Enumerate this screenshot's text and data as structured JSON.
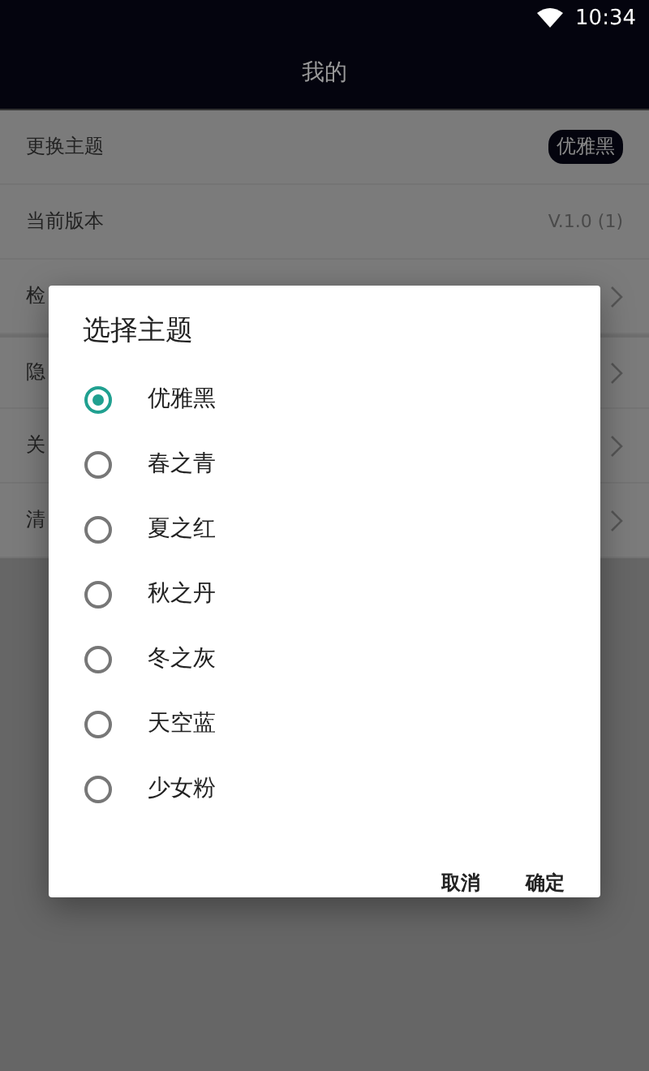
{
  "status_bar": {
    "time": "10:34"
  },
  "app_bar": {
    "title": "我的"
  },
  "settings": [
    {
      "label": "更换主题",
      "kind": "badge",
      "value": "优雅黑"
    },
    {
      "label": "当前版本",
      "kind": "text",
      "value": "V.1.0 (1)"
    },
    {
      "label": "检",
      "kind": "link"
    },
    {
      "label": "隐",
      "kind": "link"
    },
    {
      "label": "关",
      "kind": "link"
    },
    {
      "label": "清",
      "kind": "link"
    }
  ],
  "dialog": {
    "title": "选择主题",
    "options": [
      {
        "label": "优雅黑",
        "selected": true
      },
      {
        "label": "春之青",
        "selected": false
      },
      {
        "label": "夏之红",
        "selected": false
      },
      {
        "label": "秋之丹",
        "selected": false
      },
      {
        "label": "冬之灰",
        "selected": false
      },
      {
        "label": "天空蓝",
        "selected": false
      },
      {
        "label": "少女粉",
        "selected": false
      }
    ],
    "buttons": [
      "取消",
      "确定"
    ]
  }
}
